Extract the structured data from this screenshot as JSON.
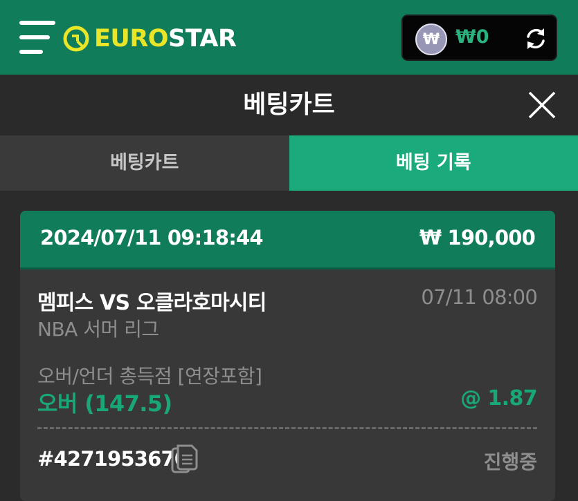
{
  "header": {
    "logo": {
      "euro": "EURO",
      "star": "STAR",
      "brand_color": "#e9e62a"
    },
    "wallet": {
      "currency_symbol": "₩",
      "balance": "₩0"
    },
    "icons": [
      "menu-icon",
      "logo-icon",
      "won-coin-icon",
      "refresh-icon"
    ]
  },
  "cart": {
    "title": "베팅카트",
    "close_icon": "close-icon"
  },
  "tabs": [
    {
      "label": "베팅카트",
      "active": false
    },
    {
      "label": "베팅 기록",
      "active": true
    }
  ],
  "bet": {
    "datetime": "2024/07/11 09:18:44",
    "amount": "₩ 190,000",
    "teams": "멤피스 VS 오클라호마시티",
    "match_time": "07/11 08:00",
    "league": "NBA 서머 리그",
    "market": "오버/언더 총득점 [연장포함]",
    "pick": "오버 (147.5)",
    "odds": "@ 1.87",
    "ticket_id": "#4271953670",
    "status": "진행중"
  },
  "colors": {
    "header_green": "#117c5a",
    "active_tab": "#1aaa7c",
    "pick_green": "#1aa777",
    "background": "#2b2b2b",
    "card": "#383838"
  }
}
